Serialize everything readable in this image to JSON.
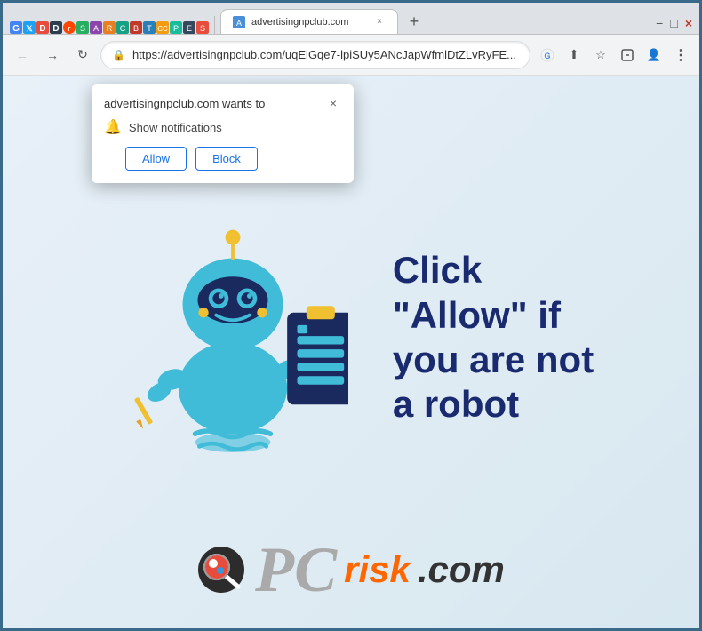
{
  "browser": {
    "tab": {
      "title": "advertisingnpclub.com",
      "close_label": "×"
    },
    "new_tab_label": "+",
    "address_bar": {
      "url": "https://advertisingnpclub.com/uqElGqe7-lpiSUy5ANcJapWfmlDtZLvRyFE...",
      "lock_icon": "🔒"
    },
    "nav": {
      "back": "←",
      "forward": "→",
      "reload": "↻"
    },
    "controls": {
      "minimize": "−",
      "maximize": "□",
      "close": "×"
    }
  },
  "popup": {
    "title": "advertisingnpclub.com wants to",
    "close_label": "×",
    "notification_text": "Show notifications",
    "allow_label": "Allow",
    "block_label": "Block"
  },
  "page": {
    "cta_line1": "Click",
    "cta_line2": "\"Allow\" if",
    "cta_line3": "you are not",
    "cta_line4": "a robot"
  },
  "footer": {
    "brand_pc": "PC",
    "brand_risk": "risk",
    "brand_com": ".com"
  },
  "icons": {
    "bell": "🔔",
    "lock": "🔒",
    "back_arrow": "←",
    "forward_arrow": "→",
    "reload": "↻",
    "star": "☆",
    "profile": "👤",
    "menu": "⋮",
    "share": "↗",
    "tab_close": "×",
    "new_tab": "+"
  }
}
